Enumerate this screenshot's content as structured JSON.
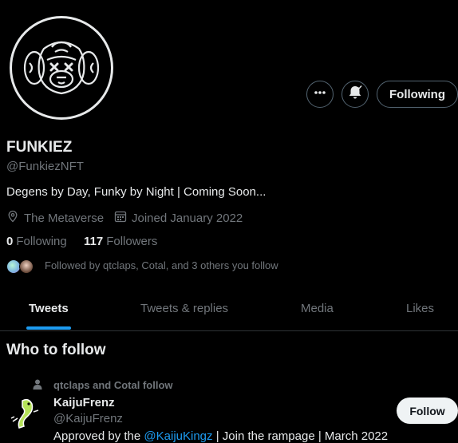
{
  "profile": {
    "name": "FUNKIEZ",
    "handle": "@FunkiezNFT",
    "bio": "Degens by Day, Funky by Night | Coming Soon...",
    "location": "The Metaverse",
    "joined": "Joined January 2022",
    "following_count": "0",
    "following_label": "Following",
    "followers_count": "117",
    "followers_label": "Followers",
    "followed_by": "Followed by qtclaps, Cotal, and 3 others you follow"
  },
  "actions": {
    "more_icon": "more-horizontal-icon",
    "notify_icon": "bell-subscribed-icon",
    "following_label": "Following"
  },
  "tabs": [
    {
      "label": "Tweets",
      "active": true
    },
    {
      "label": "Tweets & replies",
      "active": false
    },
    {
      "label": "Media",
      "active": false
    },
    {
      "label": "Likes",
      "active": false
    }
  ],
  "who_to_follow": {
    "title": "Who to follow",
    "suggestion": {
      "context": "qtclaps and Cotal follow",
      "name": "KaijuFrenz",
      "handle": "@KaijuFrenz",
      "bio_prefix": "Approved by the ",
      "bio_link": "@KaijuKingz",
      "bio_suffix": " | Join the rampage | March 2022",
      "follow_label": "Follow"
    }
  },
  "colors": {
    "background": "#000000",
    "text": "#e7e9ea",
    "muted": "#71767b",
    "accent": "#1d9bf0",
    "border": "#536471"
  }
}
